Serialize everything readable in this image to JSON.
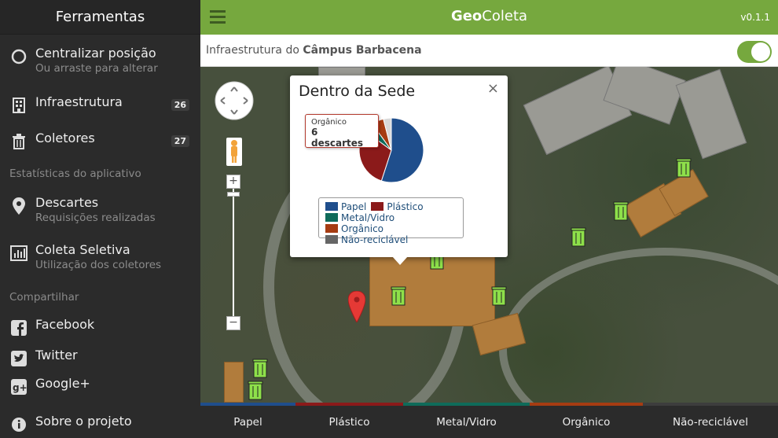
{
  "sidebar": {
    "title": "Ferramentas",
    "centralize": {
      "label": "Centralizar posição",
      "sub": "Ou arraste para alterar"
    },
    "infra": {
      "label": "Infraestrutura",
      "count": "26"
    },
    "coletores": {
      "label": "Coletores",
      "count": "27"
    },
    "stats_header": "Estatísticas do aplicativo",
    "descartes": {
      "label": "Descartes",
      "sub": "Requisições realizadas"
    },
    "coleta": {
      "label": "Coleta Seletiva",
      "sub": "Utilização dos coletores"
    },
    "share_header": "Compartilhar",
    "facebook": "Facebook",
    "twitter": "Twitter",
    "google": "Google+",
    "about": "Sobre o projeto"
  },
  "header": {
    "brand_bold": "Geo",
    "brand_rest": "Coleta",
    "version": "v0.1.1"
  },
  "subbar": {
    "prefix": "Infraestrutura do ",
    "campus": "Câmpus Barbacena"
  },
  "popup": {
    "title": "Dentro da Sede",
    "close": "×",
    "tooltip_label": "Orgânico",
    "tooltip_value": "6 descartes"
  },
  "chart_data": {
    "type": "pie",
    "title": "",
    "series": [
      {
        "name": "Papel",
        "value": 55,
        "color": "#1f4e8c"
      },
      {
        "name": "Plástico",
        "value": 30,
        "color": "#8b1a1a"
      },
      {
        "name": "Metal/Vidro",
        "value": 5,
        "color": "#0f6b5a"
      },
      {
        "name": "Orgânico",
        "value": 6,
        "color": "#a63c12"
      },
      {
        "name": "Não-reciclável",
        "value": 4,
        "color": "#d9d9d9"
      }
    ],
    "legend_items": [
      {
        "name": "Papel",
        "color": "#1f4e8c"
      },
      {
        "name": "Plástico",
        "color": "#8b1a1a"
      },
      {
        "name": "Metal/Vidro",
        "color": "#0f6b5a"
      },
      {
        "name": "Orgânico",
        "color": "#a63c12"
      },
      {
        "name": "Não-reciclável",
        "color": "#666666"
      }
    ]
  },
  "tabs": [
    {
      "label": "Papel",
      "color": "#1f4e8c"
    },
    {
      "label": "Plástico",
      "color": "#8b1a1a"
    },
    {
      "label": "Metal/Vidro",
      "color": "#0f6b5a"
    },
    {
      "label": "Orgânico",
      "color": "#a63c12"
    },
    {
      "label": "Não-reciclável",
      "color": "#3d3d3d"
    }
  ],
  "icons": [
    "circle-icon",
    "building-icon",
    "trash-icon",
    "map-pin-icon",
    "bar-chart-icon",
    "facebook-icon",
    "twitter-icon",
    "google-plus-icon",
    "info-icon",
    "hamburger-icon",
    "pan-control-icon",
    "pegman-icon",
    "zoom-in-icon",
    "zoom-out-icon",
    "trash-bin-marker-icon",
    "red-map-marker-icon"
  ]
}
